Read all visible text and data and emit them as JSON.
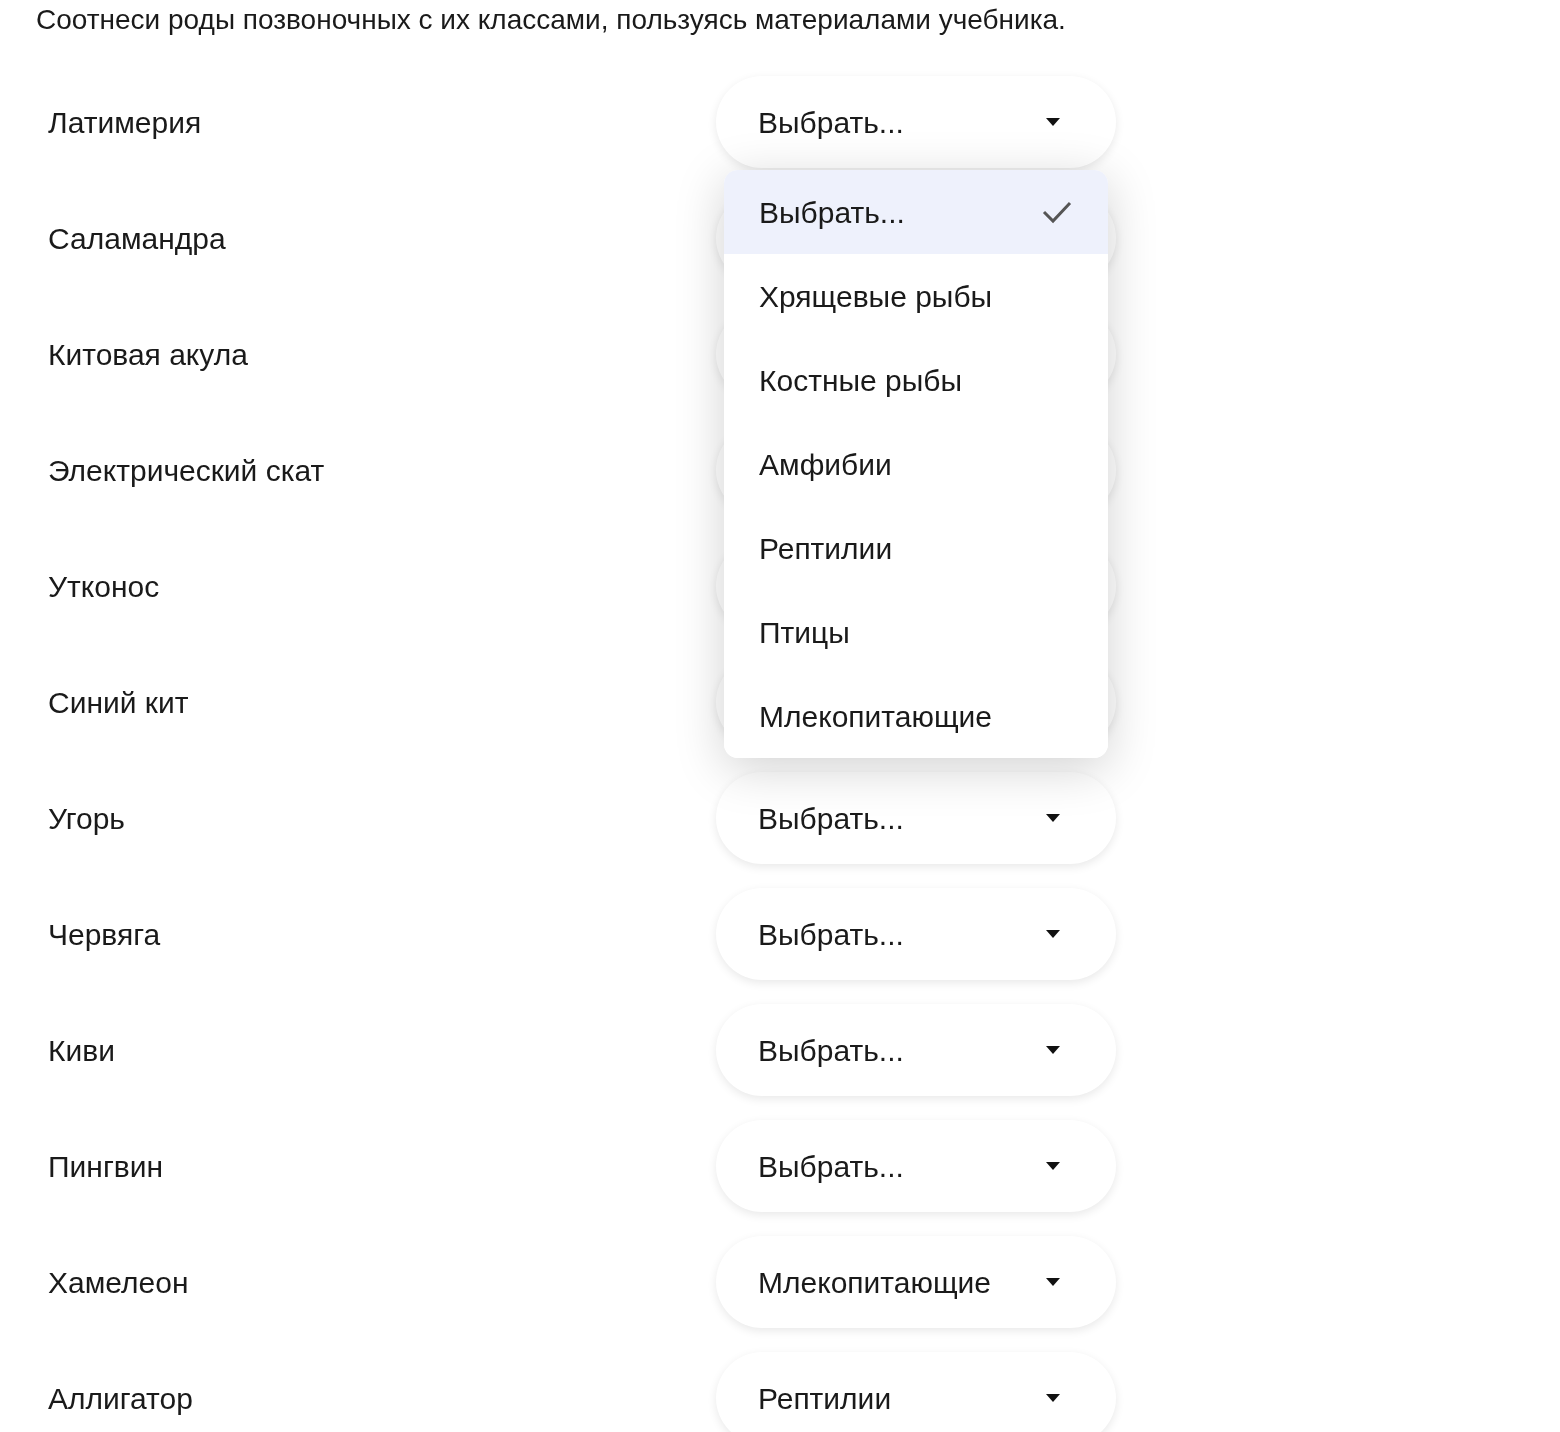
{
  "instruction": "Соотнеси роды позвоночных с их классами, пользуясь материалами учебника.",
  "rows": [
    {
      "label": "Латимерия",
      "value": "Выбрать...",
      "options": [
        {
          "label": "Выбрать...",
          "selected": true
        },
        {
          "label": "Хрящевые рыбы",
          "selected": false
        },
        {
          "label": "Костные рыбы",
          "selected": false
        },
        {
          "label": "Амфибии",
          "selected": false
        },
        {
          "label": "Рептилии",
          "selected": false
        },
        {
          "label": "Птицы",
          "selected": false
        },
        {
          "label": "Млекопитающие",
          "selected": false
        }
      ]
    },
    {
      "label": "Саламандра"
    },
    {
      "label": "Китовая акула"
    },
    {
      "label": "Электрический скат"
    },
    {
      "label": "Утконос"
    },
    {
      "label": "Синий кит"
    },
    {
      "label": "Угорь",
      "value": "Выбрать..."
    },
    {
      "label": "Червяга",
      "value": "Выбрать..."
    },
    {
      "label": "Киви",
      "value": "Выбрать..."
    },
    {
      "label": "Пингвин",
      "value": "Выбрать..."
    },
    {
      "label": "Хамелеон",
      "value": "Млекопитающие"
    },
    {
      "label": "Аллигатор",
      "value": "Рептилии"
    }
  ]
}
